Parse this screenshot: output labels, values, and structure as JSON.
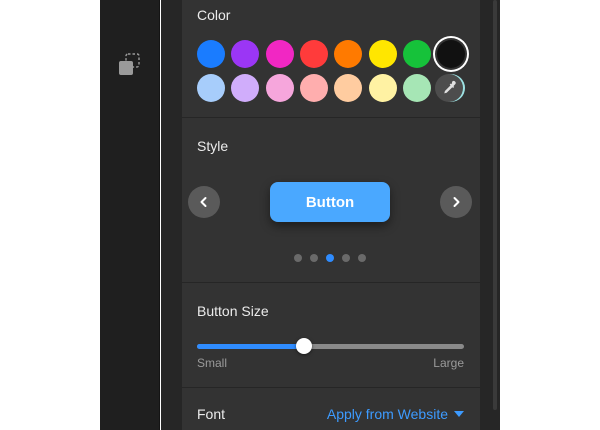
{
  "sections": {
    "color": {
      "title": "Color",
      "row1": [
        "#1a7cff",
        "#9b36f5",
        "#f127c3",
        "#ff3b3b",
        "#ff7a00",
        "#ffe600",
        "#16c23a",
        "#111111"
      ],
      "row2": [
        "#a7cdfb",
        "#d0adfb",
        "#f6a6dc",
        "#ffaeae",
        "#ffcca0",
        "#fff2a3",
        "#a6e6b5",
        "#9de2e3"
      ],
      "selected": "#111111",
      "picker_icon": "eyedropper-icon"
    },
    "style": {
      "title": "Style",
      "button_label": "Button",
      "button_color": "#4aa8ff",
      "prev_icon": "chevron-left-icon",
      "next_icon": "chevron-right-icon",
      "dot_count": 5,
      "active_dot": 2
    },
    "size": {
      "title": "Button Size",
      "min_label": "Small",
      "max_label": "Large",
      "value_fraction": 0.4
    },
    "font": {
      "label": "Font",
      "value": "Apply from Website"
    }
  },
  "toolstrip": {
    "icon": "duplicate-layers-icon"
  },
  "colors": {
    "accent": "#2f8cff",
    "panel_bg": "#333333",
    "sidebar_bg": "#1f1f1f"
  }
}
